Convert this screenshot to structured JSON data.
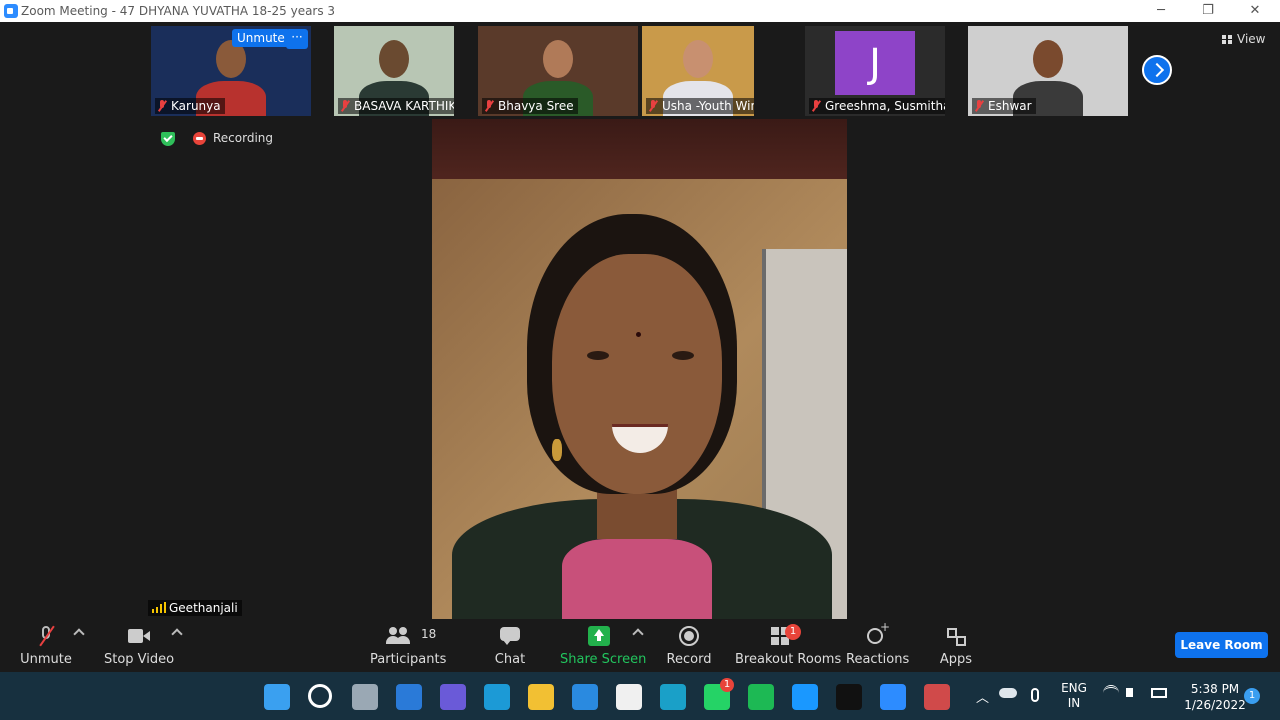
{
  "window": {
    "title": "Zoom Meeting - 47 DHYANA YUVATHA 18-25 years  3",
    "minimize": "─",
    "restore": "❐",
    "close": "✕"
  },
  "gallery": {
    "unmute_pill": "Unmute",
    "more_pill": "···",
    "view_label": "View",
    "participants": [
      {
        "name": "Karunya",
        "bg": "#1a2e5a",
        "face": "#8a5a3a",
        "body": "#b8322e"
      },
      {
        "name": "BASAVA KARTHIK",
        "bg": "#b8c6b4",
        "face": "#6a4a30",
        "body": "#2a3a34"
      },
      {
        "name": "Bhavya Sree",
        "bg": "#5a3a2a",
        "face": "#b07a58",
        "body": "#2a5a28"
      },
      {
        "name": "Usha -Youth Wing",
        "bg": "#c99a4a",
        "face": "#c89070",
        "body": "#e4e4ea"
      },
      {
        "name": "Greeshma, Susmitha",
        "bg": "#2b2b2b",
        "initial": "J",
        "avatar": "#8e44c8"
      },
      {
        "name": "Eshwar",
        "bg": "#cfcfcf",
        "face": "#7a4a2e",
        "body": "#3a3a3a"
      }
    ]
  },
  "status": {
    "recording_label": "Recording"
  },
  "main_video": {
    "speaker_name": "Geethanjali"
  },
  "toolbar": {
    "unmute": "Unmute",
    "stop_video": "Stop Video",
    "participants": "Participants",
    "participants_count": "18",
    "chat": "Chat",
    "share_screen": "Share Screen",
    "record": "Record",
    "breakout_rooms": "Breakout Rooms",
    "breakout_badge": "1",
    "reactions": "Reactions",
    "apps": "Apps",
    "leave": "Leave Room"
  },
  "taskbar": {
    "apps": [
      {
        "name": "start",
        "color": "#3aa0f0"
      },
      {
        "name": "search",
        "color": "#17303f"
      },
      {
        "name": "task-view",
        "color": "#9aa8b4"
      },
      {
        "name": "widgets",
        "color": "#2a7ad8"
      },
      {
        "name": "teams-chat",
        "color": "#6a5ad8"
      },
      {
        "name": "edge",
        "color": "#1c9ad6"
      },
      {
        "name": "file-explorer",
        "color": "#f2c033"
      },
      {
        "name": "store",
        "color": "#2a8ae0"
      },
      {
        "name": "github",
        "color": "#f0f0f0"
      },
      {
        "name": "edge-beta",
        "color": "#1aa0c8"
      },
      {
        "name": "whatsapp",
        "color": "#25d366"
      },
      {
        "name": "spotify",
        "color": "#1db954"
      },
      {
        "name": "prime-video",
        "color": "#1a98ff"
      },
      {
        "name": "netflix",
        "color": "#111111"
      },
      {
        "name": "zoom",
        "color": "#2d8cff"
      },
      {
        "name": "snipping-tool",
        "color": "#d04a4a"
      }
    ],
    "whatsapp_badge": "1",
    "lang_line1": "ENG",
    "lang_line2": "IN",
    "time": "5:38 PM",
    "date": "1/26/2022",
    "notif_count": "1"
  }
}
